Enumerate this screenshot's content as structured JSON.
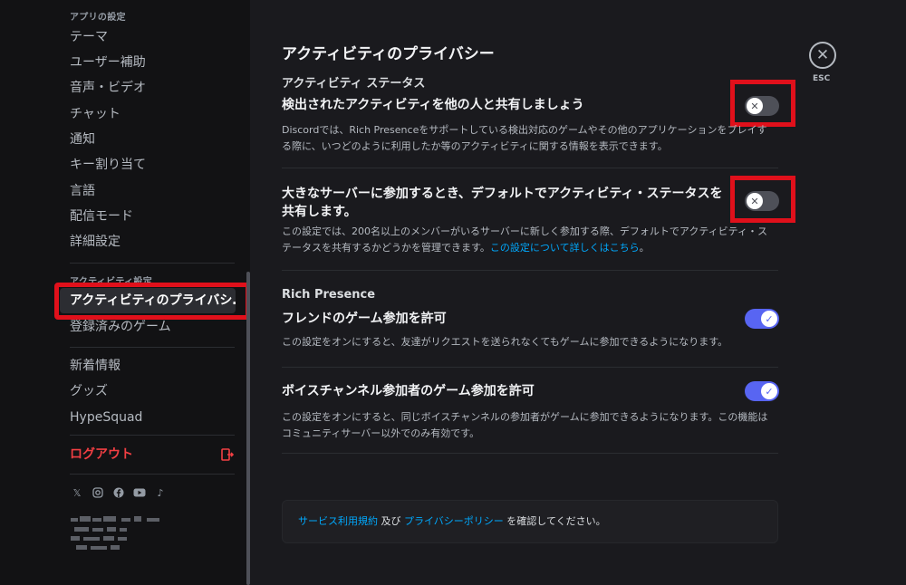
{
  "sidebar": {
    "app_settings_header": "アプリの設定",
    "app_items": [
      {
        "label": "テーマ"
      },
      {
        "label": "ユーザー補助"
      },
      {
        "label": "音声・ビデオ"
      },
      {
        "label": "チャット"
      },
      {
        "label": "通知"
      },
      {
        "label": "キー割り当て"
      },
      {
        "label": "言語"
      },
      {
        "label": "配信モード"
      },
      {
        "label": "詳細設定"
      }
    ],
    "activity_header": "アクティビティ設定",
    "activity_items": [
      {
        "label": "アクティビティのプライバシ…",
        "selected": true
      },
      {
        "label": "登録済みのゲーム"
      }
    ],
    "other_items": [
      {
        "label": "新着情報"
      },
      {
        "label": "グッズ"
      },
      {
        "label": "HypeSquad"
      }
    ],
    "logout_label": "ログアウト",
    "social_icons": [
      "x-icon",
      "instagram-icon",
      "facebook-icon",
      "youtube-icon",
      "tiktok-icon"
    ]
  },
  "main": {
    "title": "アクティビティのプライバシー",
    "close_label": "ESC",
    "sections": {
      "activity_status_label": "アクティビティ ステータス",
      "rich_presence_label": "Rich Presence"
    },
    "settings": [
      {
        "title": "検出されたアクティビティを他の人と共有しましょう",
        "desc": "Discordでは、Rich Presenceをサポートしている検出対応のゲームやその他のアプリケーションをプレイする際に、いつどのように利用したか等のアクティビティに関する情報を表示できます。",
        "enabled": false
      },
      {
        "title": "大きなサーバーに参加するとき、デフォルトでアクティビティ・ステータスを共有します。",
        "desc": "この設定では、200名以上のメンバーがいるサーバーに新しく参加する際、デフォルトでアクティビティ・ステータスを共有するかどうかを管理できます。",
        "link": "この設定について詳しくはこちら",
        "desc_end": "。",
        "enabled": false
      },
      {
        "title": "フレンドのゲーム参加を許可",
        "desc": "この設定をオンにすると、友達がリクエストを送られなくてもゲームに参加できるようになります。",
        "enabled": true
      },
      {
        "title": "ボイスチャンネル参加者のゲーム参加を許可",
        "desc": "この設定をオンにすると、同じボイスチャンネルの参加者がゲームに参加できるようになります。この機能はコミュニティサーバー以外でのみ有効です。",
        "enabled": true
      }
    ],
    "footer": {
      "terms_link": "サービス利用規約",
      "and": " 及び ",
      "privacy_link": "プライバシーポリシー",
      "suffix": " を確認してください。"
    }
  },
  "colors": {
    "accent": "#5865f2",
    "danger": "#f23f43",
    "highlight": "#e0101b",
    "link": "#00a8fc"
  }
}
